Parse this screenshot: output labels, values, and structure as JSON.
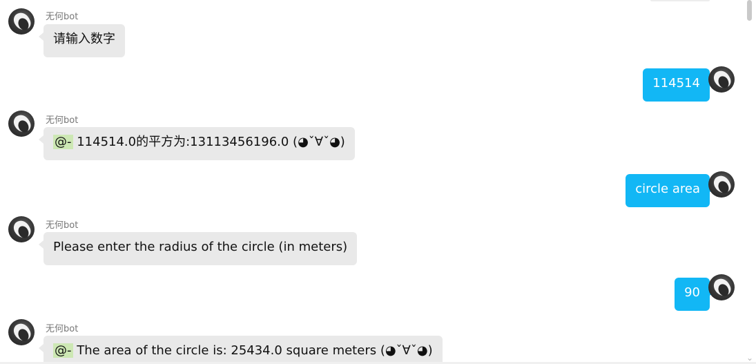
{
  "messages": [
    {
      "side": "in",
      "sender": "无何bot",
      "text": "请输入数字"
    },
    {
      "side": "out",
      "text": "114514"
    },
    {
      "side": "in",
      "sender": "无何bot",
      "mention": "@-",
      "text": " 114514.0的平方为:13113456196.0 (◕ˇ∀ˇ◕)"
    },
    {
      "side": "out",
      "text": "circle area"
    },
    {
      "side": "in",
      "sender": "无何bot",
      "text": "Please enter the radius of the circle (in meters)"
    },
    {
      "side": "out",
      "text": "90"
    },
    {
      "side": "in",
      "sender": "无何bot",
      "mention": "@-",
      "text": " The area of the circle is: 25434.0 square meters (◕ˇ∀ˇ◕)"
    }
  ],
  "scrollbar": {
    "arrow": "⌄"
  }
}
